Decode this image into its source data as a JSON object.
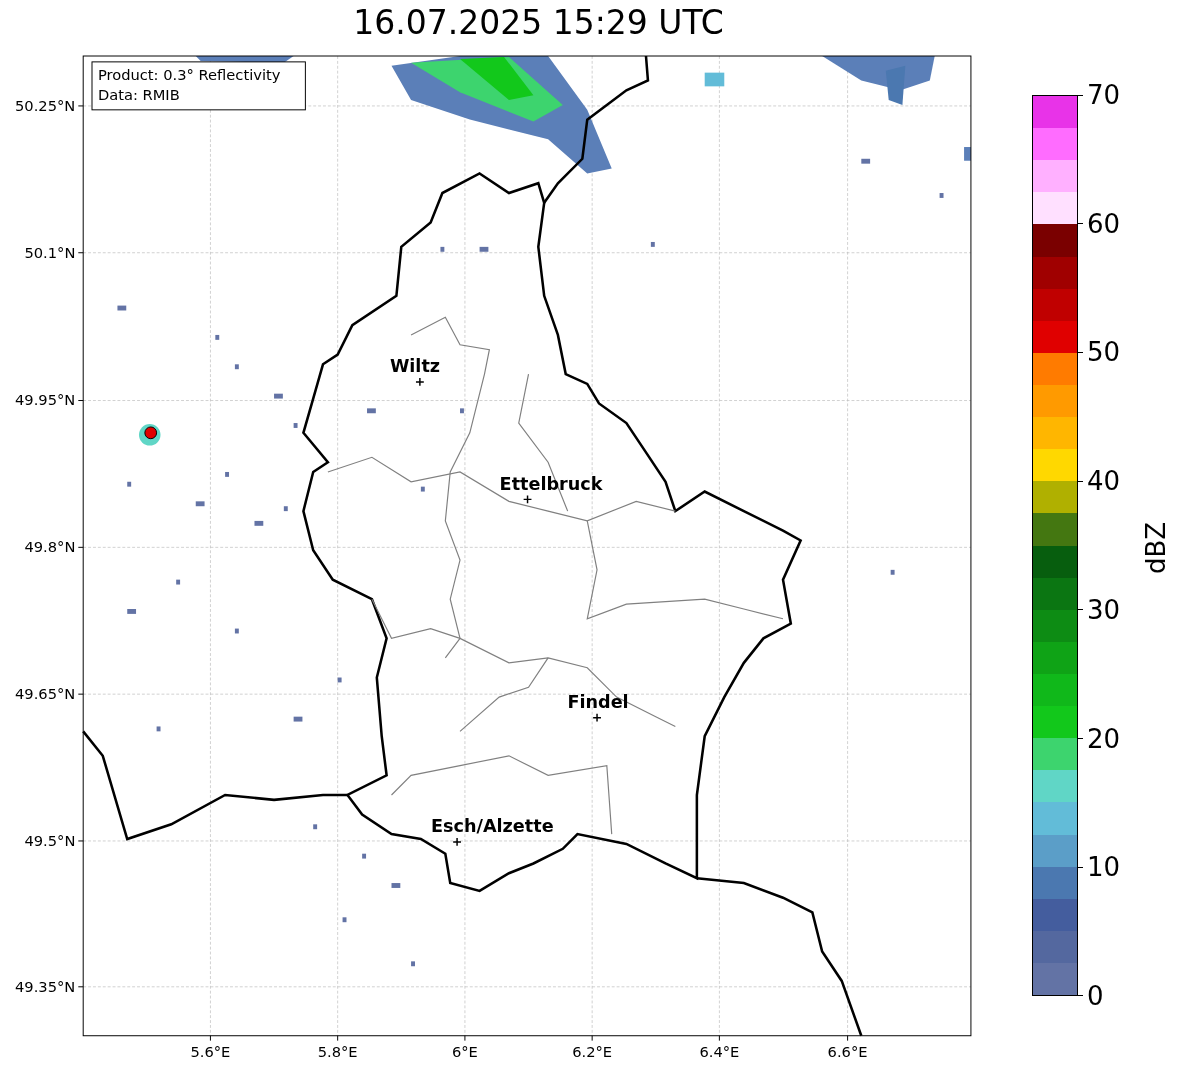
{
  "title": "16.07.2025 15:29 UTC",
  "info_box": {
    "lines": [
      "Product: 0.3° Reflectivity",
      "Data: RMIB"
    ]
  },
  "map": {
    "x_ticks": [
      "5.6°E",
      "5.8°E",
      "6°E",
      "6.2°E",
      "6.4°E",
      "6.6°E"
    ],
    "y_ticks": [
      "50.25°N",
      "50.1°N",
      "49.95°N",
      "49.8°N",
      "49.65°N",
      "49.5°N",
      "49.35°N"
    ],
    "cities": [
      {
        "name": "Wiltz"
      },
      {
        "name": "Ettelbruck"
      },
      {
        "name": "Findel"
      },
      {
        "name": "Esch/Alzette"
      }
    ]
  },
  "colorbar": {
    "label": "dBZ",
    "ticks": [
      "70",
      "60",
      "50",
      "40",
      "30",
      "20",
      "10",
      "0"
    ],
    "segments": [
      {
        "color": "#e833e8"
      },
      {
        "color": "#ff6cff"
      },
      {
        "color": "#ffb0ff"
      },
      {
        "color": "#ffe0ff"
      },
      {
        "color": "#7a0000"
      },
      {
        "color": "#a00000"
      },
      {
        "color": "#c00000"
      },
      {
        "color": "#e00000"
      },
      {
        "color": "#ff7b00"
      },
      {
        "color": "#ff9a00"
      },
      {
        "color": "#ffb600"
      },
      {
        "color": "#ffd800"
      },
      {
        "color": "#b0b000"
      },
      {
        "color": "#447711"
      },
      {
        "color": "#075e0e"
      },
      {
        "color": "#0b7612"
      },
      {
        "color": "#0d8c14"
      },
      {
        "color": "#0fa316"
      },
      {
        "color": "#10b81a"
      },
      {
        "color": "#12c81b"
      },
      {
        "color": "#3dd46e"
      },
      {
        "color": "#60d6c6"
      },
      {
        "color": "#62bcd8"
      },
      {
        "color": "#5b9ec8"
      },
      {
        "color": "#4b78b0"
      },
      {
        "color": "#445d9e"
      },
      {
        "color": "#54689f"
      },
      {
        "color": "#6373a5"
      }
    ]
  }
}
